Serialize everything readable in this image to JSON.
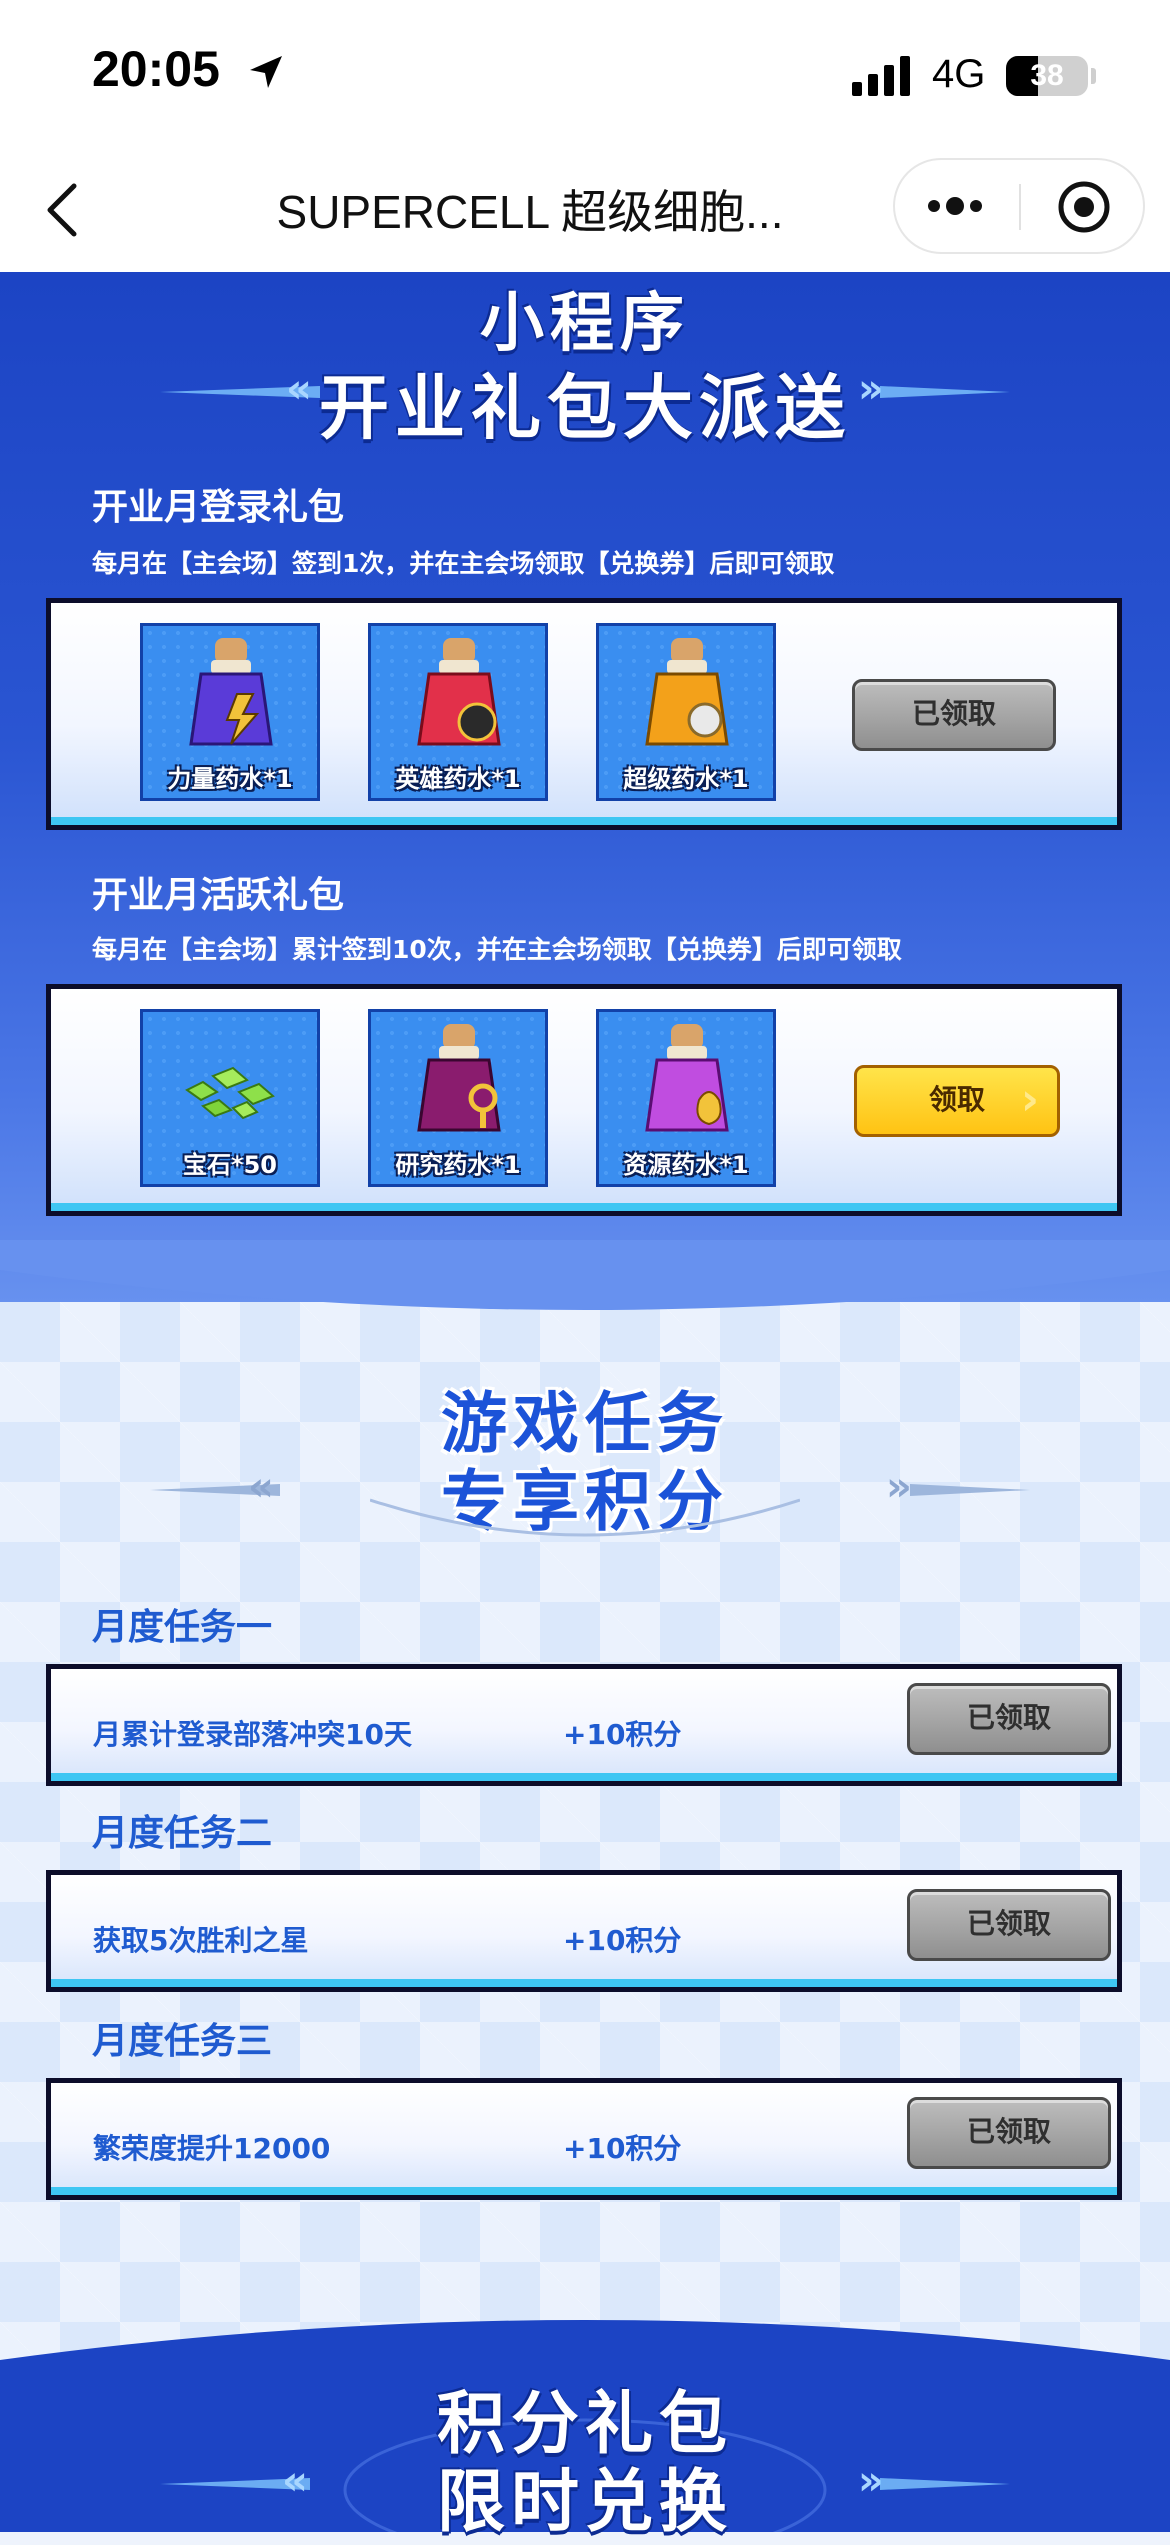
{
  "status_bar": {
    "time": "20:05",
    "network": "4G",
    "battery": "38"
  },
  "nav": {
    "title": "SUPERCELL 超级细胞..."
  },
  "banner1": {
    "line1": "小程序",
    "line2": "开业礼包大派送"
  },
  "login_gift": {
    "title": "开业月登录礼包",
    "subtitle": "每月在【主会场】签到1次，并在主会场领取【兑换券】后即可领取",
    "items": [
      {
        "label": "力量药水*1",
        "icon": "strength-potion-icon",
        "color": "#5a3bd8"
      },
      {
        "label": "英雄药水*1",
        "icon": "hero-potion-icon",
        "color": "#e2304a"
      },
      {
        "label": "超级药水*1",
        "icon": "super-potion-icon",
        "color": "#f3a11a"
      }
    ],
    "button": "已领取"
  },
  "active_gift": {
    "title": "开业月活跃礼包",
    "subtitle": "每月在【主会场】累计签到10次，并在主会场领取【兑换券】后即可领取",
    "items": [
      {
        "label": "宝石*50",
        "icon": "gems-icon",
        "color": "#7fd43a"
      },
      {
        "label": "研究药水*1",
        "icon": "research-potion-icon",
        "color": "#8a1c6e"
      },
      {
        "label": "资源药水*1",
        "icon": "resource-potion-icon",
        "color": "#c04de0"
      }
    ],
    "button": "领取"
  },
  "banner2": {
    "line1": "游戏任务",
    "line2": "专享积分"
  },
  "tasks": [
    {
      "header": "月度任务一",
      "name": "月累计登录部落冲突10天",
      "points": "+10积分",
      "button": "已领取"
    },
    {
      "header": "月度任务二",
      "name": "获取5次胜利之星",
      "points": "+10积分",
      "button": "已领取"
    },
    {
      "header": "月度任务三",
      "name": "繁荣度提升12000",
      "points": "+10积分",
      "button": "已领取"
    }
  ],
  "banner3": {
    "line1": "积分礼包",
    "line2": "限时兑换"
  },
  "colors": {
    "primary_blue": "#2a55d2",
    "accent_cyan": "#3ec6f3",
    "claim_yellow": "#ffc313"
  }
}
